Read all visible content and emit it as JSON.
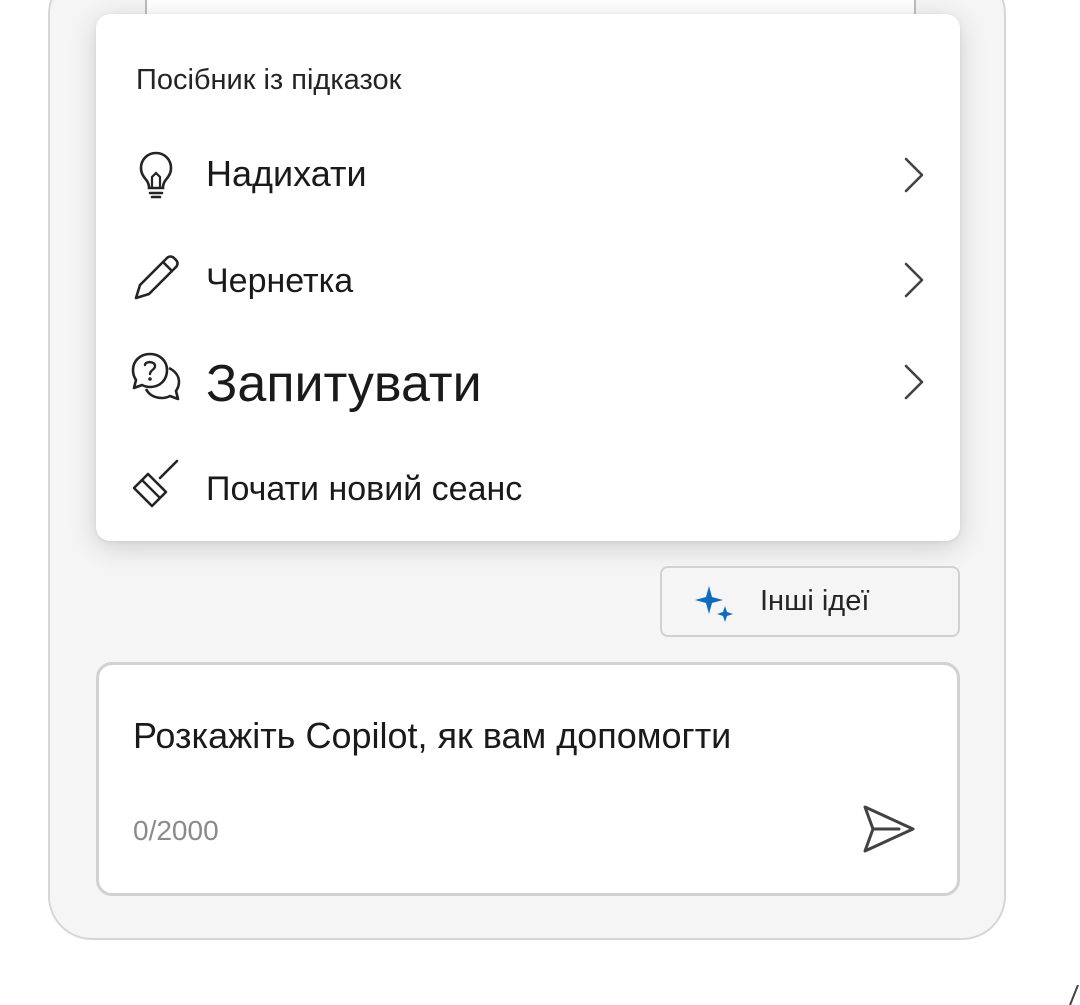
{
  "menu": {
    "header": "Посібник із підказок",
    "items": [
      {
        "label": "Надихати",
        "icon": "lightbulb-icon",
        "has_submenu": true
      },
      {
        "label": "Чернетка",
        "icon": "pencil-icon",
        "has_submenu": true
      },
      {
        "label": "Запитувати",
        "icon": "question-chat-icon",
        "has_submenu": true
      },
      {
        "label": "Почати новий сеанс",
        "icon": "broom-icon",
        "has_submenu": false
      }
    ]
  },
  "ideas_button": {
    "label": "Інші ідеї",
    "icon": "sparkle-icon",
    "icon_color": "#0f6cbd"
  },
  "composer": {
    "placeholder": "Розкажіть Copilot, як вам допомогти",
    "counter": "0/2000",
    "send_icon": "send-icon"
  }
}
